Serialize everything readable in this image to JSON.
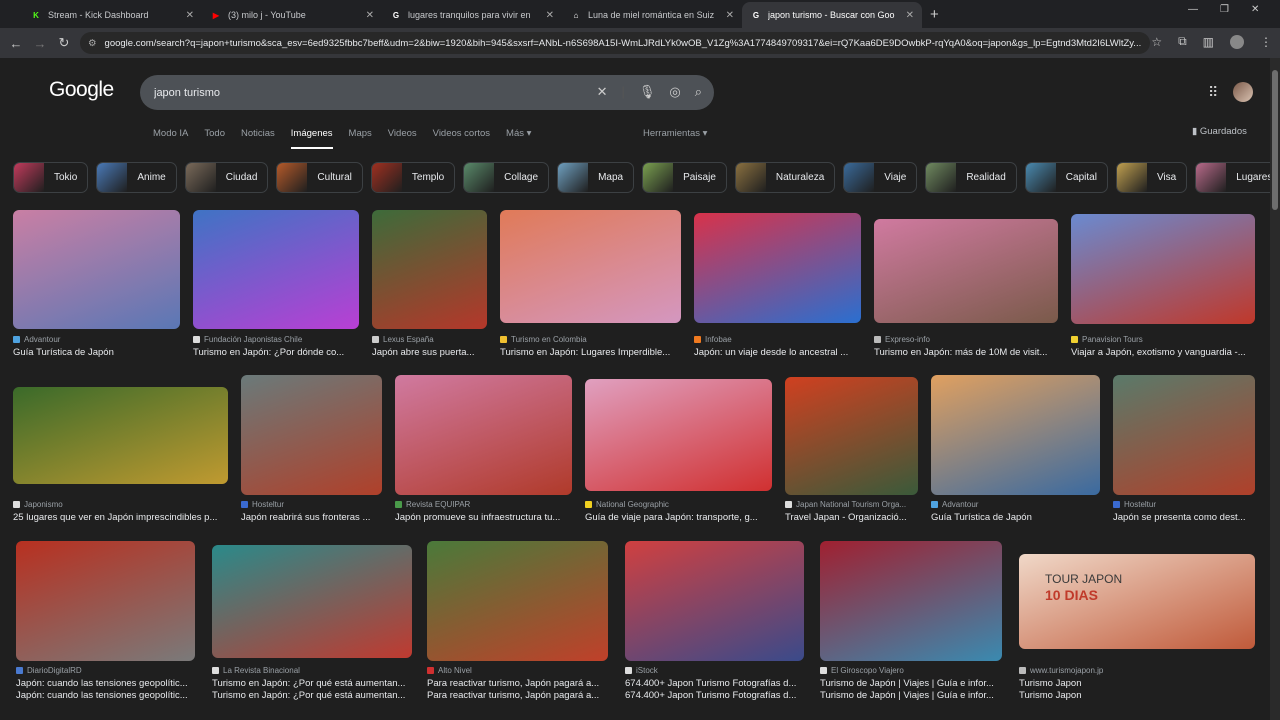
{
  "tabs": [
    {
      "title": "Stream - Kick Dashboard",
      "fav": "K",
      "color": "#53fc18"
    },
    {
      "title": "(3) milo j - YouTube",
      "fav": "▶",
      "color": "#ff0000"
    },
    {
      "title": "lugares tranquilos para vivir en",
      "fav": "G",
      "color": "#ffffff"
    },
    {
      "title": "Luna de miel romántica en Suiz",
      "fav": "⌂",
      "color": "#ffffff"
    },
    {
      "title": "japon turismo - Buscar con Goo",
      "fav": "G",
      "color": "#ffffff"
    }
  ],
  "address": "google.com/search?q=japon+turismo&sca_esv=6ed9325fbbc7beff&udm=2&biw=1920&bih=945&sxsrf=ANbL-n6S698A15I-WmLJRdLYk0wOB_V1Zg%3A1774849709317&ei=rQ7Kaa6DE9DOwbkP-rqYqA0&oq=japon&gs_lp=Egtnd3Mtd2I6LWltZy...",
  "logo": "Google",
  "query": "japon turismo",
  "navtabs": [
    "Modo IA",
    "Todo",
    "Noticias",
    "Imágenes",
    "Maps",
    "Videos",
    "Videos cortos",
    "Más ▾"
  ],
  "tools": "Herramientas ▾",
  "saved": "Guardados",
  "chips": [
    {
      "label": "Tokio",
      "c": "#c23b5c"
    },
    {
      "label": "Anime",
      "c": "#4a7ab8"
    },
    {
      "label": "Ciudad",
      "c": "#7a6a5a"
    },
    {
      "label": "Cultural",
      "c": "#b55a2a"
    },
    {
      "label": "Templo",
      "c": "#a03020"
    },
    {
      "label": "Collage",
      "c": "#5a8a6a"
    },
    {
      "label": "Mapa",
      "c": "#6fa0c0"
    },
    {
      "label": "Paisaje",
      "c": "#7aa050"
    },
    {
      "label": "Naturaleza",
      "c": "#8a7040"
    },
    {
      "label": "Viaje",
      "c": "#3a6a9a"
    },
    {
      "label": "Realidad",
      "c": "#708a60"
    },
    {
      "label": "Capital",
      "c": "#4a8ab0"
    },
    {
      "label": "Visa",
      "c": "#c0a050"
    },
    {
      "label": "Lugares",
      "c": "#b86a8a"
    }
  ],
  "results": [
    {
      "src": "Advantour",
      "title": "Guía Turística de Japón",
      "c1": "#c97fa4",
      "c2": "#5a77b5",
      "ic": "#4fa3e0"
    },
    {
      "src": "Fundación Japonistas Chile",
      "title": "Turismo en Japón: ¿Por dónde co...",
      "c1": "#3f73c4",
      "c2": "#b93fd4",
      "ic": "#dddddd"
    },
    {
      "src": "Lexus España",
      "title": "Japón abre sus puerta...",
      "c1": "#3d6b3a",
      "c2": "#b5372a",
      "ic": "#cccccc"
    },
    {
      "src": "Turismo en Colombia",
      "title": "Turismo en Japón: Lugares Imperdible...",
      "c1": "#e07a58",
      "c2": "#d497c0",
      "ic": "#f0c030"
    },
    {
      "src": "Infobae",
      "title": "Japón: un viaje desde lo ancestral ...",
      "c1": "#d8324a",
      "c2": "#2a6fd0",
      "ic": "#f07a20"
    },
    {
      "src": "Expreso-info",
      "title": "Turismo en Japón: más de 10M de visit...",
      "c1": "#d07aa0",
      "c2": "#7a5a4a",
      "ic": "#bbbbbb"
    },
    {
      "src": "Panavision Tours",
      "title": "Viajar a Japón, exotismo y vanguardia -...",
      "c1": "#6a8ad0",
      "c2": "#c0382a",
      "ic": "#f0d030"
    },
    {
      "src": "Japonismo",
      "title": "25 lugares que ver en Japón imprescindibles p...",
      "c1": "#3a6a2a",
      "c2": "#c09a30",
      "ic": "#dddddd"
    },
    {
      "src": "Hosteltur",
      "title": "Japón reabrirá sus fronteras ...",
      "c1": "#6a7a7a",
      "c2": "#b0402a",
      "ic": "#3a6ad0"
    },
    {
      "src": "Revista EQUIPAR",
      "title": "Japón promueve su infraestructura tu...",
      "c1": "#d07aa0",
      "c2": "#b03a2a",
      "ic": "#4a9a4a"
    },
    {
      "src": "National Geographic",
      "title": "Guía de viaje para Japón: transporte, g...",
      "c1": "#e0a0c0",
      "c2": "#d03030",
      "ic": "#f0d020"
    },
    {
      "src": "Japan National Tourism Orga...",
      "title": "Travel Japan - Organizació...",
      "c1": "#d04020",
      "c2": "#3a5a3a",
      "ic": "#dddddd"
    },
    {
      "src": "Advantour",
      "title": "Guía Turística de Japón",
      "c1": "#e0a060",
      "c2": "#3a6aa0",
      "ic": "#4fa3e0"
    },
    {
      "src": "Hosteltur",
      "title": "Japón se presenta como dest...",
      "c1": "#5a7a6a",
      "c2": "#b0402a",
      "ic": "#3a6ad0"
    },
    {
      "src": "DiarioDigitalRD",
      "title": "Japón: cuando las tensiones geopolític...",
      "title2": "Japón: cuando las tensiones geopolític...",
      "c1": "#b83020",
      "c2": "#7a7a7a",
      "ic": "#4a7ad0"
    },
    {
      "src": "La Revista Binacional",
      "title": "Turismo en Japón: ¿Por qué está aumentan...",
      "title2": "Turismo en Japón: ¿Por qué está aumentan...",
      "c1": "#2a8a8a",
      "c2": "#c03a30",
      "ic": "#dddddd"
    },
    {
      "src": "Alto Nivel",
      "title": "Para reactivar turismo, Japón pagará a...",
      "title2": "Para reactivar turismo, Japón pagará a...",
      "c1": "#4a7a3a",
      "c2": "#c0402a",
      "ic": "#d03030"
    },
    {
      "src": "iStock",
      "title": "674.400+ Japon Turismo Fotografías d...",
      "title2": "674.400+ Japon Turismo Fotografías d...",
      "c1": "#d04040",
      "c2": "#3a4a8a",
      "ic": "#dddddd"
    },
    {
      "src": "El Giroscopo Viajero",
      "title": "Turismo de Japón | Viajes | Guía e infor...",
      "title2": "Turismo de Japón | Viajes | Guía e infor...",
      "c1": "#a02030",
      "c2": "#3a8ab0",
      "ic": "#dddddd"
    },
    {
      "src": "www.turismojapon.jp",
      "title": "Turismo Japon",
      "title2": "Turismo Japon",
      "c1": "#f0d8c8",
      "c2": "#c05a3a",
      "ic": "#bbbbbb"
    }
  ],
  "overlay": {
    "line1": "TOUR JAPON",
    "line2": "10 DIAS"
  }
}
